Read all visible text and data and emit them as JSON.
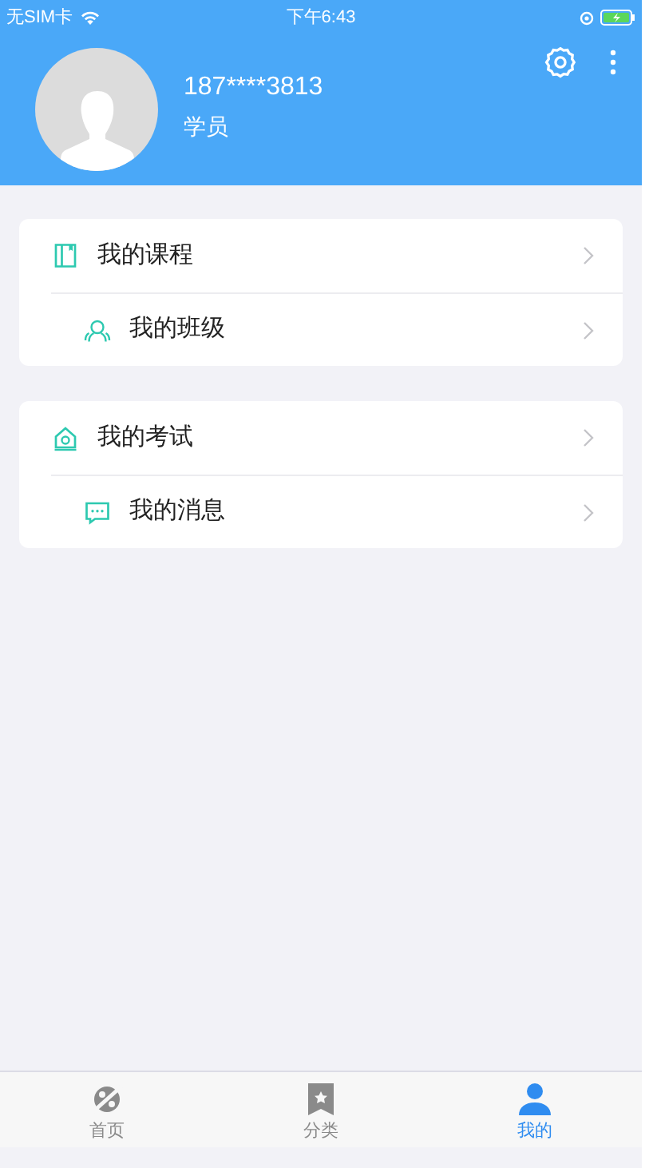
{
  "status_bar": {
    "carrier": "无SIM卡",
    "time": "下午6:43"
  },
  "profile": {
    "phone": "187****3813",
    "role": "学员"
  },
  "menu_groups": [
    {
      "items": [
        {
          "label": "我的课程"
        },
        {
          "label": "我的班级"
        }
      ]
    },
    {
      "items": [
        {
          "label": "我的考试"
        },
        {
          "label": "我的消息"
        }
      ]
    }
  ],
  "tab_bar": [
    {
      "label": "首页",
      "selected": false
    },
    {
      "label": "分类",
      "selected": false
    },
    {
      "label": "我的",
      "selected": true
    }
  ]
}
